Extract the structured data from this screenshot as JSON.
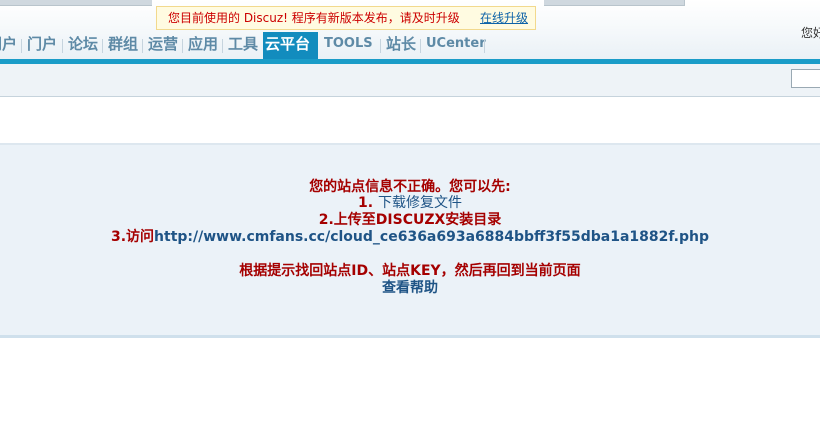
{
  "notice": {
    "message": "您目前使用的 Discuz! 程序有新版本发布，请及时升级",
    "link": "在线升级"
  },
  "user": {
    "greeting": "您好"
  },
  "nav": {
    "items": [
      {
        "label": "门户",
        "active": false
      },
      {
        "label": "门户",
        "active": false
      },
      {
        "label": "论坛",
        "active": false
      },
      {
        "label": "群组",
        "active": false
      },
      {
        "label": "运营",
        "active": false
      },
      {
        "label": "应用",
        "active": false
      },
      {
        "label": "工具",
        "active": false
      },
      {
        "label": "云平台",
        "active": true
      },
      {
        "label": "TOOLS",
        "active": false
      },
      {
        "label": "站长",
        "active": false
      },
      {
        "label": "UCenter",
        "active": false
      }
    ]
  },
  "message": {
    "title": "您的站点信息不正确。您可以先:",
    "step1_num": "1.",
    "step1_link": "下载修复文件",
    "step2": "2.上传至DISCUZX安装目录",
    "step3_prefix": "3.访问",
    "step3_url": "http://www.cmfans.cc/cloud_ce636a693a6884bbff3f55dba1a1882f.php",
    "instruction": "根据提示找回站点ID、站点KEY，然后再回到当前页面",
    "help_link": "查看帮助"
  }
}
